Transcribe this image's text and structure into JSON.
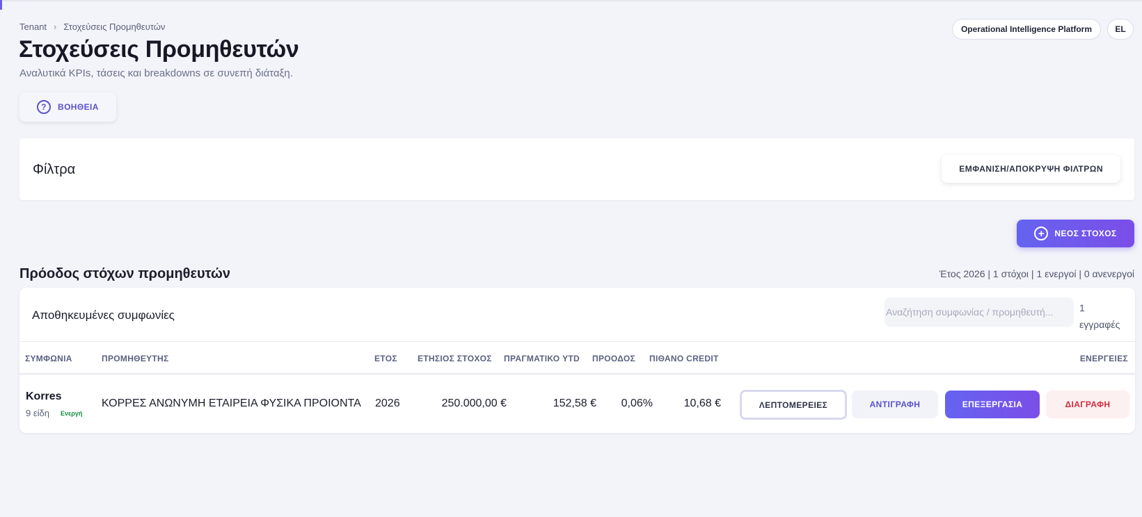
{
  "breadcrumb": {
    "root": "Tenant",
    "current": "Στοχεύσεις Προμηθευτών"
  },
  "header": {
    "title": "Στοχεύσεις Προμηθευτών",
    "subtitle": "Αναλυτικά KPIs, τάσεις και breakdowns σε συνεπή διάταξη.",
    "platform_pill": "Operational Intelligence Platform",
    "language_pill": "EL"
  },
  "help": {
    "label": "ΒΟΗΘΕΙΑ",
    "icon": "?"
  },
  "filters": {
    "title": "Φίλτρα",
    "toggle_label": "ΕΜΦΑΝΙΣΗ/ΑΠΟΚΡΥΨΗ ΦΙΛΤΡΩΝ"
  },
  "new_target": {
    "label": "ΝΕΟΣ ΣΤΟΧΟΣ",
    "icon": "+"
  },
  "progress": {
    "title": "Πρόοδος στόχων προμηθευτών",
    "summary": "Έτος 2026 | 1 στόχοι | 1 ενεργοί | 0 ανενεργοί"
  },
  "table": {
    "title": "Αποθηκευμένες συμφωνίες",
    "search_placeholder": "Αναζήτηση συμφωνίας / προμηθευτή...",
    "search_value": "",
    "record_count": "1 εγγραφές",
    "columns": {
      "agreement": "ΣΥΜΦΩΝΙΑ",
      "supplier": "ΠΡΟΜΗΘΕΥΤΗΣ",
      "year": "ΕΤΟΣ",
      "annual_target": "ΕΤΗΣΙΟΣ ΣΤΟΧΟΣ",
      "actual_ytd": "ΠΡΑΓΜΑΤΙΚΟ YTD",
      "progress": "ΠΡΟΟΔΟΣ",
      "probable_credit": "ΠΙΘΑΝΟ CREDIT",
      "actions": "ΕΝΕΡΓΕΙΕΣ"
    },
    "rows": [
      {
        "agreement": "Korres",
        "items": "9 είδη",
        "status": "Ενεργή",
        "supplier": "ΚΟΡΡΕΣ ΑΝΩΝΥΜΗ ΕΤΑΙΡΕΙΑ ΦΥΣΙΚΑ ΠΡΟΙΟΝΤΑ",
        "year": "2026",
        "annual_target": "250.000,00 €",
        "actual_ytd": "152,58 €",
        "progress": "0,06%",
        "probable_credit": "10,68 €",
        "actions": {
          "details": "ΛΕΠΤΟΜΕΡΕΙΕΣ",
          "copy": "ΑΝΤΙΓΡΑΦΗ",
          "edit": "ΕΠΕΞΕΡΓΑΣΙΑ",
          "delete": "ΔΙΑΓΡΑΦΗ"
        }
      }
    ]
  },
  "colors": {
    "accent": "#6b5ce7",
    "accent_gradient_end": "#7b4ee8",
    "status_active": "#16893f",
    "danger": "#d12c3a",
    "background": "#f3f4f9"
  }
}
